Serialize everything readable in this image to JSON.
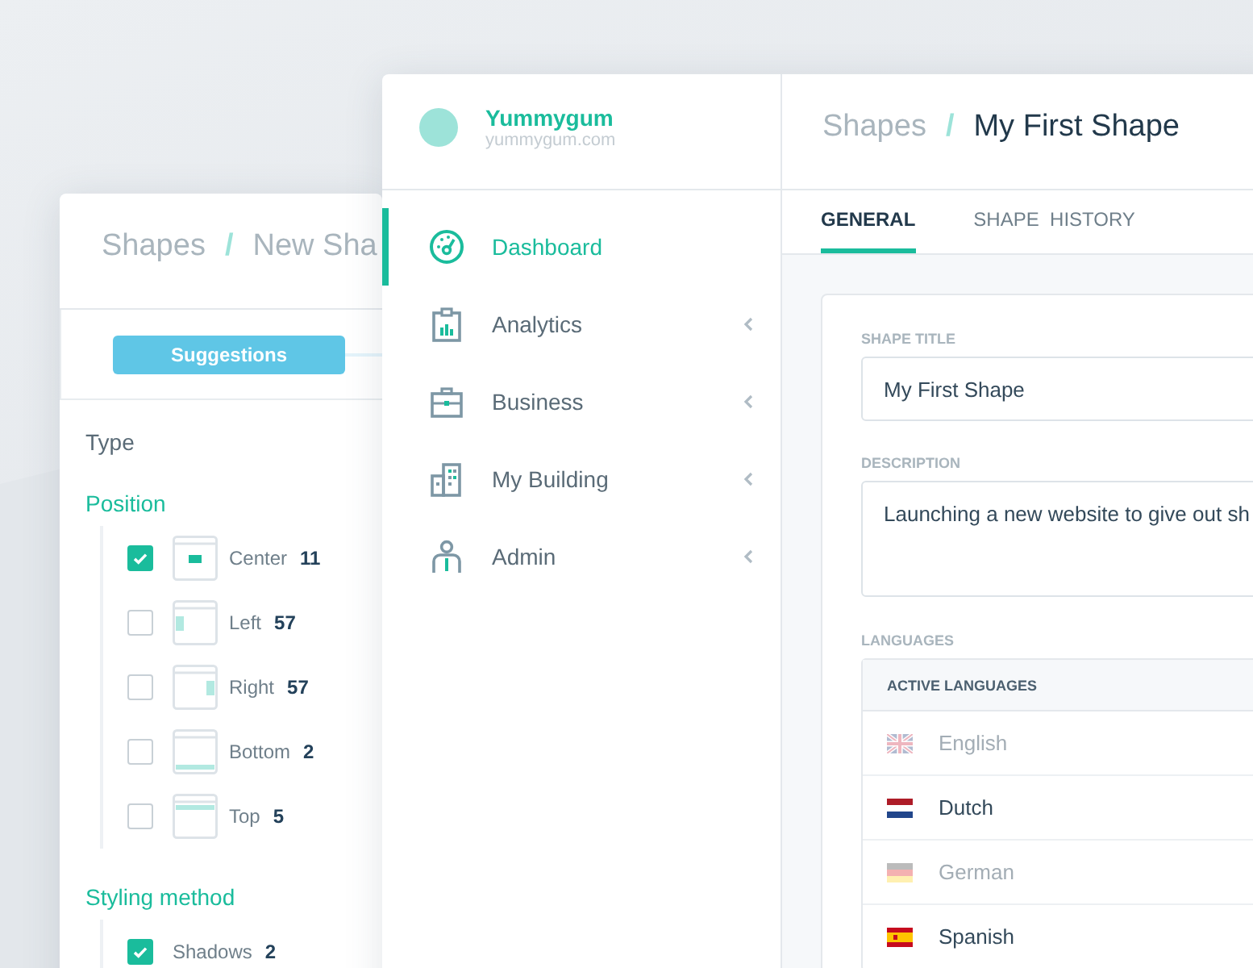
{
  "back_window": {
    "breadcrumb": {
      "root": "Shapes",
      "separator": "/",
      "current": "New Sha"
    },
    "suggestions_button": "Suggestions",
    "type_heading": "Type",
    "groups": [
      {
        "title": "Position",
        "items": [
          {
            "label": "Center",
            "count": "11",
            "checked": true,
            "kind": "center"
          },
          {
            "label": "Left",
            "count": "57",
            "checked": false,
            "kind": "left"
          },
          {
            "label": "Right",
            "count": "57",
            "checked": false,
            "kind": "right"
          },
          {
            "label": "Bottom",
            "count": "2",
            "checked": false,
            "kind": "bottom"
          },
          {
            "label": "Top",
            "count": "5",
            "checked": false,
            "kind": "top"
          }
        ]
      },
      {
        "title": "Styling method",
        "items": [
          {
            "label": "Shadows",
            "count": "2",
            "checked": true
          }
        ]
      }
    ]
  },
  "front_window": {
    "account": {
      "name": "Yummygum",
      "domain": "yummygum.com"
    },
    "sidebar": {
      "items": [
        {
          "label": "Dashboard",
          "kind": "dashboard",
          "selected": true,
          "expandable": false
        },
        {
          "label": "Analytics",
          "kind": "analytics",
          "selected": false,
          "expandable": true
        },
        {
          "label": "Business",
          "kind": "business",
          "selected": false,
          "expandable": true
        },
        {
          "label": "My Building",
          "kind": "building",
          "selected": false,
          "expandable": true
        },
        {
          "label": "Admin",
          "kind": "admin",
          "selected": false,
          "expandable": true
        }
      ]
    },
    "breadcrumb": {
      "root": "Shapes",
      "separator": "/",
      "current": "My First Shape"
    },
    "tabs": [
      {
        "label": "GENERAL",
        "selected": true
      },
      {
        "label": "SHAPE  HISTORY",
        "selected": false
      }
    ],
    "form": {
      "title_label": "SHAPE TITLE",
      "title_value": "My First Shape",
      "description_label": "DESCRIPTION",
      "description_value": "Launching a new website to give out sh",
      "languages_label": "LANGUAGES",
      "languages_header": "ACTIVE LANGUAGES",
      "languages": [
        {
          "name": "English",
          "kind": "uk",
          "enabled": false
        },
        {
          "name": "Dutch",
          "kind": "nl",
          "enabled": true
        },
        {
          "name": "German",
          "kind": "de",
          "enabled": false
        },
        {
          "name": "Spanish",
          "kind": "es",
          "enabled": true
        }
      ]
    }
  }
}
